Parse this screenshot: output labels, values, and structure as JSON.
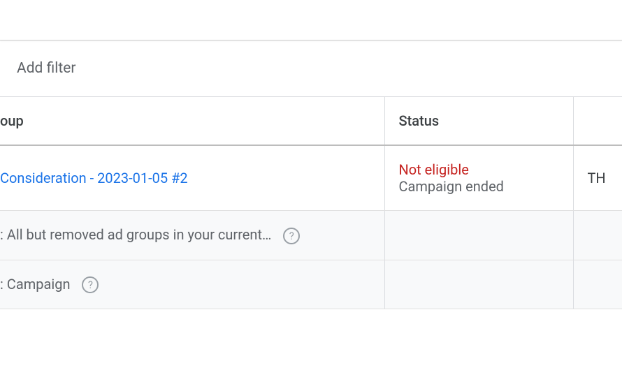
{
  "filter": {
    "label": "Add filter"
  },
  "table": {
    "headers": {
      "group": "oup",
      "status": "Status",
      "last": ""
    },
    "rows": [
      {
        "group_text": " Consideration - 2023-01-05 #2",
        "status_primary": "Not eligible",
        "status_secondary": "Campaign ended",
        "last": "TH"
      },
      {
        "summary_text": ": All but removed ad groups in your current…"
      },
      {
        "summary_text": ": Campaign"
      }
    ]
  },
  "icons": {
    "help": "?"
  }
}
